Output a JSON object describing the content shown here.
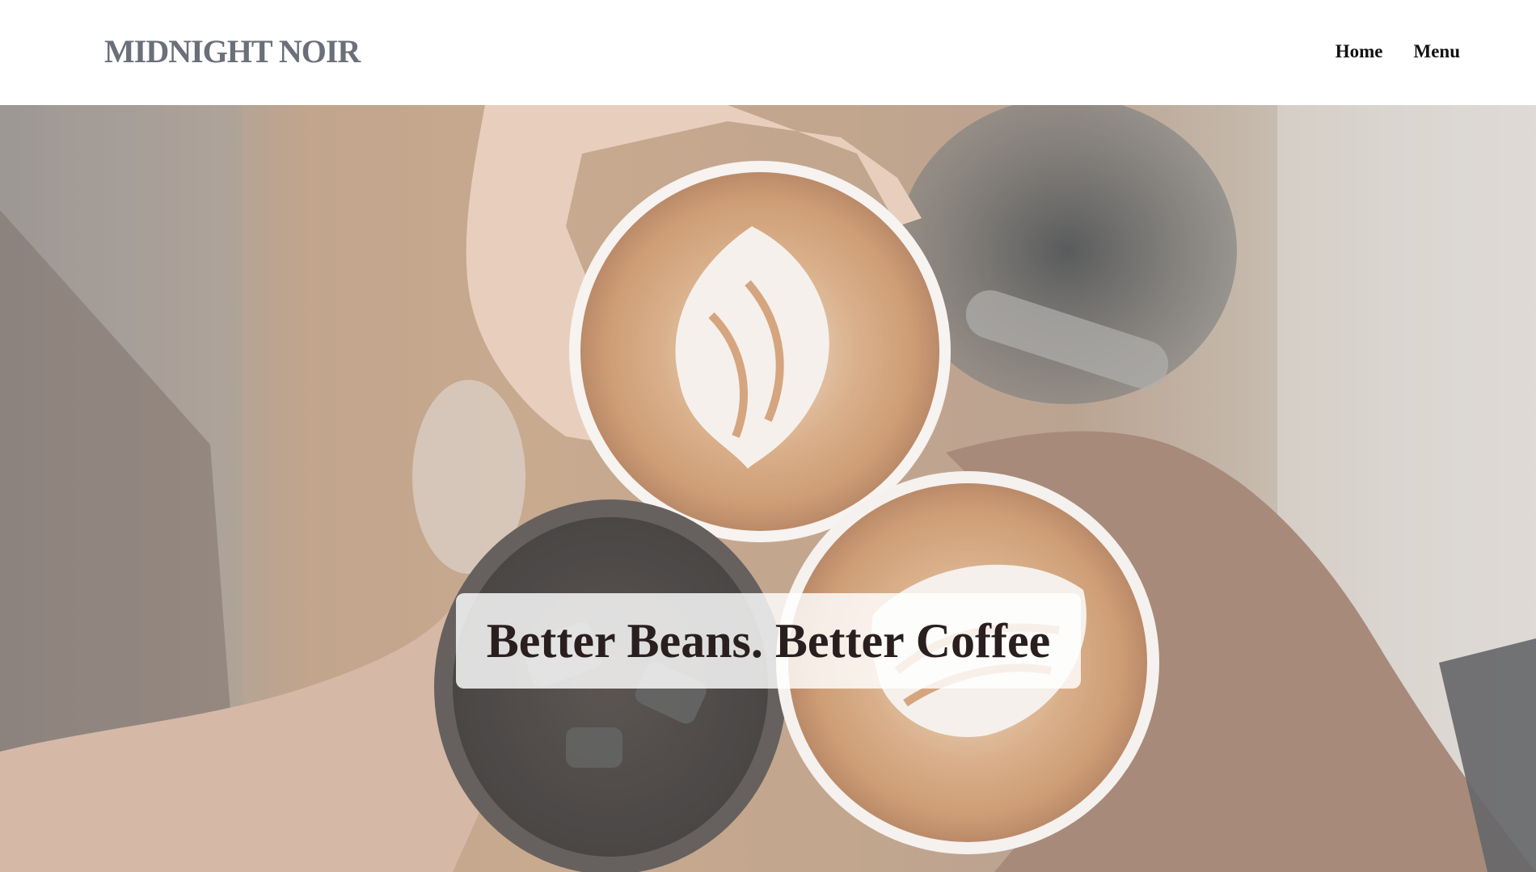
{
  "brand": {
    "name": "MIDNIGHT NOIR"
  },
  "nav": {
    "items": [
      {
        "label": "Home"
      },
      {
        "label": "Menu"
      }
    ]
  },
  "hero": {
    "headline": "Better Beans. Better Coffee",
    "image_icon": "coffee-cups-photo"
  },
  "colors": {
    "brand_text": "#6b6f7a",
    "nav_text": "#111111",
    "headline_text": "#2a1f1f",
    "headline_box_bg": "#ffffff"
  }
}
